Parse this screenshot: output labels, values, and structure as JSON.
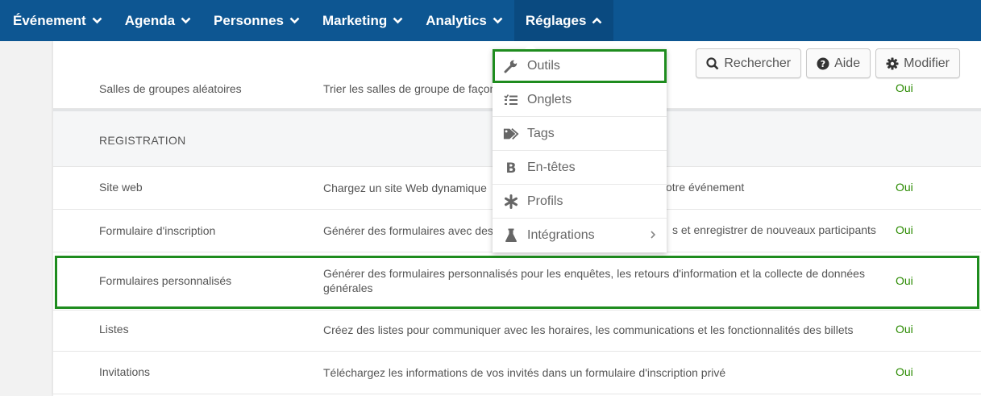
{
  "nav": {
    "items": [
      {
        "label": "Événement"
      },
      {
        "label": "Agenda"
      },
      {
        "label": "Personnes"
      },
      {
        "label": "Marketing"
      },
      {
        "label": "Analytics"
      },
      {
        "label": "Réglages"
      }
    ]
  },
  "toolbar": {
    "search_label": "Rechercher",
    "help_label": "Aide",
    "edit_label": "Modifier"
  },
  "dropdown": {
    "items": [
      {
        "label": "Outils",
        "icon": "wrench-icon"
      },
      {
        "label": "Onglets",
        "icon": "list-icon"
      },
      {
        "label": "Tags",
        "icon": "tags-icon"
      },
      {
        "label": "En-têtes",
        "icon": "bold-icon"
      },
      {
        "label": "Profils",
        "icon": "asterisk-icon"
      },
      {
        "label": "Intégrations",
        "icon": "flask-icon"
      }
    ]
  },
  "rows": [
    {
      "name": "Salles de groupes aléatoires",
      "desc": "Trier les salles de groupe de façon",
      "status": "Oui"
    },
    {
      "name": "REGISTRATION"
    },
    {
      "name": "Site web",
      "desc": "Chargez un site Web dynamique",
      "desc_end": "votre événement",
      "status": "Oui"
    },
    {
      "name": "Formulaire d'inscription",
      "desc": "Générer des formulaires avec des",
      "desc_end": "s et enregistrer de nouveaux participants",
      "status": "Oui"
    },
    {
      "name": "Formulaires personnalisés",
      "desc": "Générer des formulaires personnalisés pour les enquêtes, les retours d'information et la collecte de données générales",
      "status": "Oui"
    },
    {
      "name": "Listes",
      "desc": "Créez des listes pour communiquer avec les horaires, les communications et les fonctionnalités des billets",
      "status": "Oui"
    },
    {
      "name": "Invitations",
      "desc": "Téléchargez les informations de vos invités dans un formulaire d'inscription privé",
      "status": "Oui"
    }
  ],
  "colors": {
    "nav_bg": "#0d5692",
    "highlight": "#1e8c1e",
    "status_green": "#2a8a00"
  }
}
